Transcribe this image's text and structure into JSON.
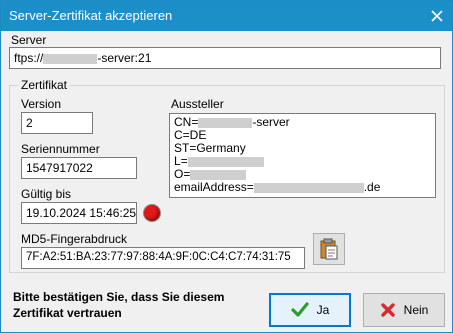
{
  "window": {
    "title": "Server-Zertifikat akzeptieren"
  },
  "server": {
    "label": "Server",
    "value_prefix": "ftps://",
    "value_suffix": "-server:21"
  },
  "certificate": {
    "group_title": "Zertifikat",
    "version_label": "Version",
    "version_value": "2",
    "serial_label": "Seriennummer",
    "serial_value": "1547917022",
    "valid_label": "Gültig bis",
    "valid_value": "19.10.2024 15:46:25",
    "issuer_label": "Aussteller",
    "issuer": {
      "cn_prefix": "CN=",
      "cn_suffix": "-server",
      "c": "C=DE",
      "st": "ST=Germany",
      "l_prefix": "L=",
      "o_prefix": "O=",
      "email_prefix": "emailAddress=",
      "email_suffix": ".de"
    },
    "md5_label": "MD5-Fingerabdruck",
    "md5_value": "7F:A2:51:BA:23:77:97:88:4A:9F:0C:C4:C7:74:31:75"
  },
  "footer": {
    "message": "Bitte bestätigen Sie, dass Sie diesem Zertifikat vertrauen",
    "yes_label": "Ja",
    "no_label": "Nein"
  },
  "colors": {
    "titlebar": "#1c8fc9",
    "status_dot": "#e11919",
    "yes_check": "#2e9b2e",
    "no_x": "#d62b2b"
  }
}
